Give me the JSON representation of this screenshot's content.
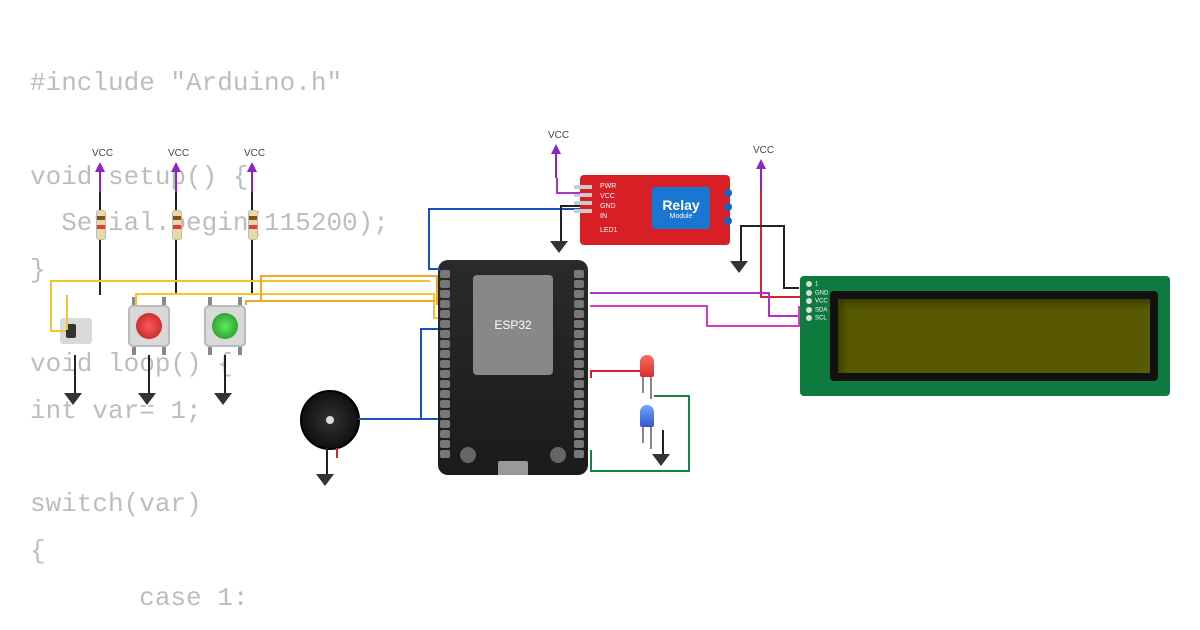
{
  "code_background": "#include \"Arduino.h\"\n\nvoid setup() {\n  Serial.begin(115200);\n}\n\nvoid loop() {\nint var= 1;\n\nswitch(var)\n{\n       case 1:",
  "labels": {
    "vcc": "VCC",
    "esp32": "ESP32",
    "relay_title": "Relay",
    "relay_sub": "Module"
  },
  "relay_pins": [
    "PWR",
    "VCC",
    "GND",
    "IN",
    "LED1"
  ],
  "lcd_pins": [
    "1",
    "GND",
    "VCC",
    "SDA",
    "SCL"
  ],
  "components": {
    "buttons": [
      {
        "color": "red",
        "name": "red-push-button"
      },
      {
        "color": "green",
        "name": "green-push-button"
      }
    ],
    "leds": [
      {
        "color": "red"
      },
      {
        "color": "blue"
      }
    ],
    "mcu": "ESP32 DevKit",
    "slide_switch": true,
    "buzzer": true,
    "relay_module": true,
    "lcd_i2c_16x2": true,
    "resistors_pullup": 3
  },
  "wiring": [
    {
      "from": "slide-switch",
      "to": "ESP32-GPIO",
      "color": "yellow"
    },
    {
      "from": "red-push-button",
      "to": "ESP32-GPIO",
      "color": "yellow"
    },
    {
      "from": "green-push-button",
      "to": "ESP32-GPIO",
      "color": "orange"
    },
    {
      "from": "ESP32-GPIO",
      "to": "relay-IN",
      "color": "blue"
    },
    {
      "from": "ESP32-GPIO",
      "to": "buzzer",
      "color": "blue"
    },
    {
      "from": "ESP32-GPIO",
      "to": "led-red",
      "color": "red"
    },
    {
      "from": "ESP32-GPIO",
      "to": "led-blue",
      "color": "green"
    },
    {
      "from": "ESP32-SDA",
      "to": "LCD-SDA",
      "color": "magenta"
    },
    {
      "from": "ESP32-SCL",
      "to": "LCD-SCL",
      "color": "purple"
    },
    {
      "from": "LCD-VCC",
      "to": "relay-rail",
      "color": "red"
    },
    {
      "from": "LCD-GND",
      "to": "GND",
      "color": "black"
    },
    {
      "from": "relay-VCC",
      "to": "VCC",
      "color": "purple"
    },
    {
      "from": "relay-GND",
      "to": "GND",
      "color": "black"
    },
    {
      "from": "buttons/switch",
      "to": "GND",
      "color": "black"
    },
    {
      "from": "resistors",
      "to": "VCC",
      "color": "purple"
    }
  ]
}
